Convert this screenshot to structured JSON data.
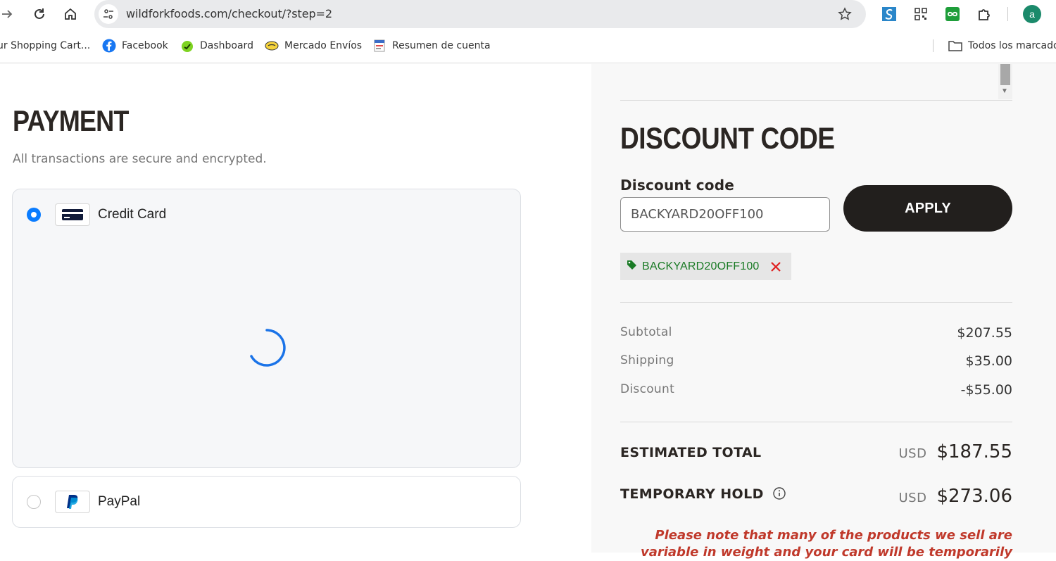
{
  "browser": {
    "url": "wildforkfoods.com/checkout/?step=2",
    "avatar_letter": "a",
    "bookmarks": [
      {
        "label": "ur Shopping Cart...",
        "icon": "cart-icon"
      },
      {
        "label": "Facebook",
        "icon": "facebook-icon"
      },
      {
        "label": "Dashboard",
        "icon": "dashboard-icon"
      },
      {
        "label": "Mercado Envíos",
        "icon": "mercado-icon"
      },
      {
        "label": "Resumen de cuenta",
        "icon": "account-summary-icon"
      }
    ],
    "all_bookmarks_label": "Todos los marcadores"
  },
  "payment": {
    "title": "PAYMENT",
    "subtitle": "All transactions are secure and encrypted.",
    "methods": [
      {
        "label": "Credit Card",
        "selected": true,
        "icon": "credit-card-icon"
      },
      {
        "label": "PayPal",
        "selected": false,
        "icon": "paypal-icon"
      }
    ]
  },
  "discount": {
    "title": "DISCOUNT CODE",
    "field_label": "Discount code",
    "field_value": "BACKYARD20OFF100",
    "apply_label": "APPLY",
    "applied_code": "BACKYARD20OFF100"
  },
  "summary": {
    "rows": [
      {
        "label": "Subtotal",
        "value": "$207.55"
      },
      {
        "label": "Shipping",
        "value": "$35.00"
      },
      {
        "label": "Discount",
        "value": "-$55.00"
      }
    ],
    "estimated_total": {
      "label": "ESTIMATED TOTAL",
      "currency": "USD",
      "amount": "$187.55"
    },
    "temporary_hold": {
      "label": "TEMPORARY HOLD",
      "currency": "USD",
      "amount": "$273.06"
    },
    "note": "Please note that many of the products we sell are variable in weight and your card will be temporarily"
  },
  "colors": {
    "accent_blue": "#0a7cff",
    "apply_button": "#221f1d",
    "applied_code_green": "#1a7a25",
    "note_red": "#c0392b"
  }
}
